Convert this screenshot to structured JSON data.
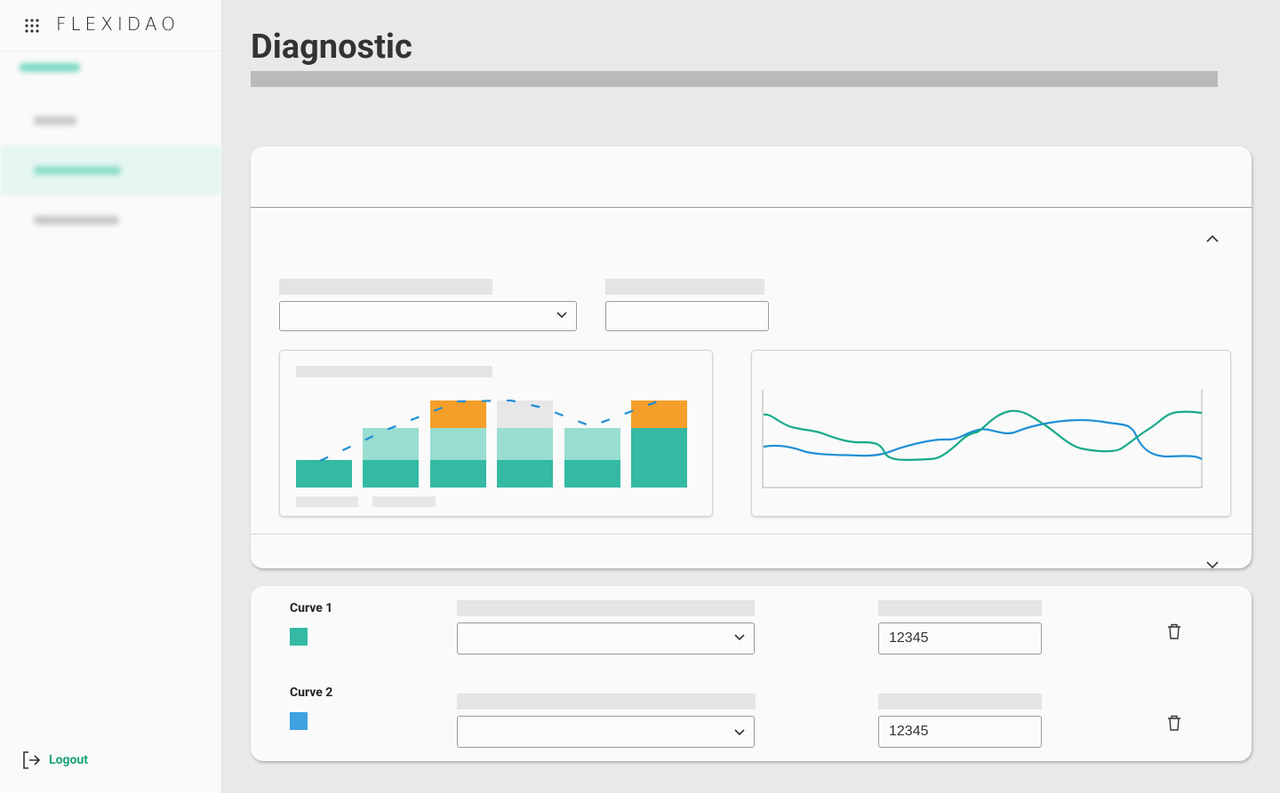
{
  "app": {
    "logo_text": "FLEXIDAO",
    "logout_label": "Logout"
  },
  "page": {
    "title": "Diagnostic"
  },
  "curves": [
    {
      "label": "Curve 1",
      "color": "#34b9a3",
      "value": "12345"
    },
    {
      "label": "Curve 2",
      "color": "#3fa1e0",
      "value": "12345"
    }
  ],
  "colors": {
    "accent": "#19a27c",
    "teal": "#34b9a3",
    "teal_light": "#99ddd1",
    "orange": "#f59f2a",
    "gray_bar": "#e6e6e6",
    "blue": "#1d8ed6",
    "green_line": "#17a98b"
  },
  "icons": [
    "apps-grid-icon",
    "logout-icon",
    "chevron-up-icon",
    "chevron-down-icon",
    "trash-icon"
  ]
}
